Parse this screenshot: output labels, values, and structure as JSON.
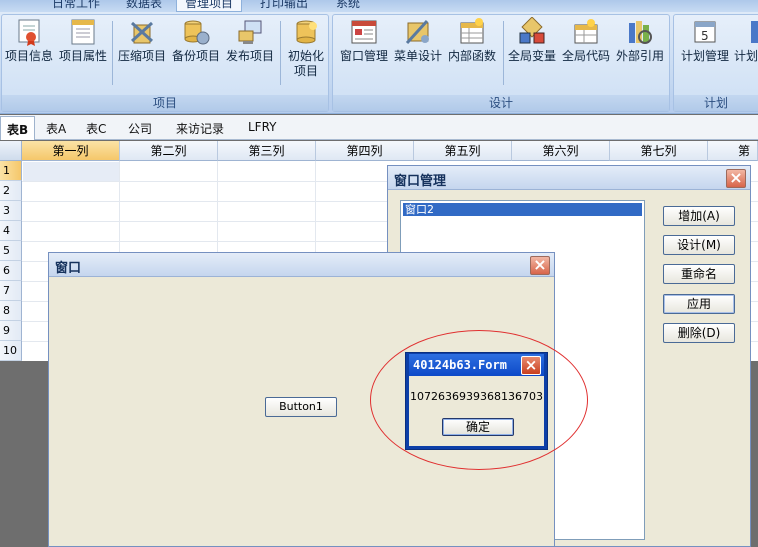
{
  "ribbon": {
    "tabs": [
      "日常工作",
      "数据表",
      "管理项目",
      "打印输出",
      "系统"
    ],
    "active_tab": "管理项目",
    "groups": [
      {
        "label": "项目",
        "buttons": [
          "项目信息",
          "项目属性",
          "压缩项目",
          "备份项目",
          "发布项目",
          "初始化项目"
        ]
      },
      {
        "label": "设计",
        "buttons": [
          "窗口管理",
          "菜单设计",
          "内部函数",
          "全局变量",
          "全局代码",
          "外部引用"
        ]
      },
      {
        "label": "计划",
        "buttons": [
          "计划管理",
          "计划"
        ]
      }
    ]
  },
  "sheet_tabs": [
    "表B",
    "表A",
    "表C",
    "公司",
    "来访记录",
    "LFRY"
  ],
  "active_sheet": "表B",
  "grid": {
    "columns": [
      "第一列",
      "第二列",
      "第三列",
      "第四列",
      "第五列",
      "第六列",
      "第七列",
      "第八"
    ],
    "rows": [
      "1",
      "2",
      "3",
      "4",
      "5",
      "6",
      "7",
      "8",
      "9",
      "10"
    ]
  },
  "window_manager": {
    "title": "窗口管理",
    "list_items": [
      "窗口2"
    ],
    "buttons": [
      "增加(A)",
      "设计(M)",
      "重命名",
      "应用",
      "删除(D)"
    ]
  },
  "form_window": {
    "title": "窗口",
    "button_label": "Button1"
  },
  "message_box": {
    "title": "40124b63.Form",
    "text": "1072636939368136703",
    "ok_label": "确定"
  },
  "icons": {
    "close": "close-icon"
  },
  "colors": {
    "accent_red": "#e03030",
    "selection_blue": "#316ac5",
    "header_orange": "#f5c76a"
  }
}
